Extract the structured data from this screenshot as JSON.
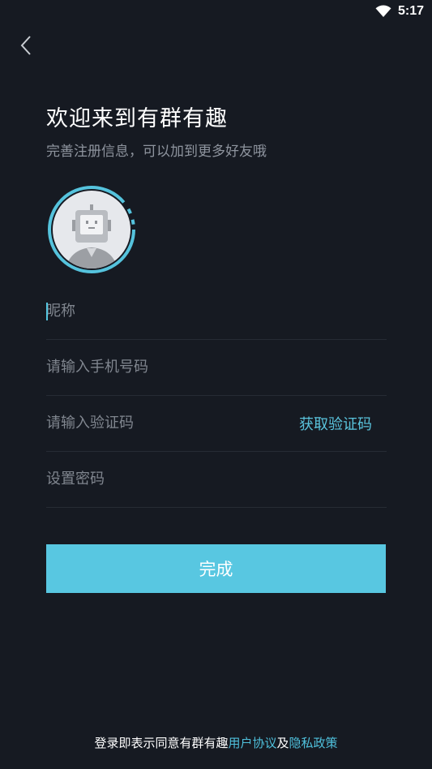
{
  "status_bar": {
    "time": "5:17"
  },
  "header": {
    "title": "欢迎来到有群有趣",
    "subtitle": "完善注册信息，可以加到更多好友哦"
  },
  "form": {
    "nickname": {
      "placeholder": "昵称",
      "value": ""
    },
    "phone": {
      "placeholder": "请输入手机号码",
      "value": ""
    },
    "code": {
      "placeholder": "请输入验证码",
      "value": "",
      "action_label": "获取验证码"
    },
    "password": {
      "placeholder": "设置密码",
      "value": ""
    },
    "submit_label": "完成"
  },
  "footer": {
    "prefix": "登录即表示同意有群有趣",
    "user_agreement": "用户协议",
    "conjunction": "及",
    "privacy_policy": "隐私政策"
  },
  "colors": {
    "background": "#161a22",
    "accent": "#58c7e1",
    "link": "#4fc0dc"
  },
  "icons": {
    "back": "chevron-left-icon",
    "wifi": "wifi-icon",
    "avatar": "robot-avatar-icon"
  }
}
